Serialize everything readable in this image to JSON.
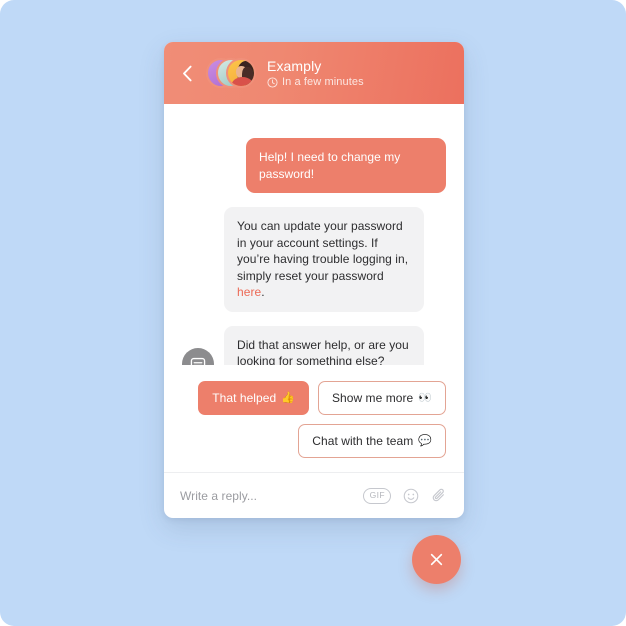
{
  "colors": {
    "page_background": "#bfd9f7",
    "card_background": "#ffffff",
    "brand_coral": "#ed7f6b",
    "brand_coral_dark": "#ec705e",
    "incoming_bubble": "#f2f2f3",
    "link_coral": "#ec6a56",
    "bot_avatar_gray": "#8c8c8e",
    "placeholder_gray": "#9b9ca1"
  },
  "header": {
    "back_label": "Back",
    "title": "Examply",
    "subtitle": "In a few minutes",
    "clock_icon": "clock-icon",
    "avatar_count": 3
  },
  "conversation": {
    "messages": [
      {
        "id": "msg-user-request",
        "direction": "outgoing",
        "text": "Help! I need to change my password!"
      },
      {
        "id": "msg-bot-answer",
        "direction": "incoming",
        "text_before_link": "You can update your password in your account settings. If you’re having trouble logging in, simply reset your password ",
        "link_text": "here",
        "text_after_link": "."
      },
      {
        "id": "msg-bot-followup",
        "direction": "incoming",
        "avatar_icon": "chat-bot-icon",
        "text": "Did that answer help, or are you looking for something else?"
      }
    ]
  },
  "quick_replies": [
    {
      "id": "qr-that-helped",
      "label": "That helped",
      "emoji": "👍",
      "style": "primary"
    },
    {
      "id": "qr-show-more",
      "label": "Show me more",
      "emoji": "👀",
      "style": "outline"
    },
    {
      "id": "qr-chat-team",
      "label": "Chat with the team",
      "emoji": "💬",
      "style": "outline"
    }
  ],
  "composer": {
    "placeholder": "Write a reply...",
    "value": "",
    "gif_label": "GIF",
    "emoji_icon": "smiley-icon",
    "attachment_icon": "paperclip-icon"
  },
  "launcher": {
    "close_icon": "close-icon",
    "label": "Close messenger"
  }
}
